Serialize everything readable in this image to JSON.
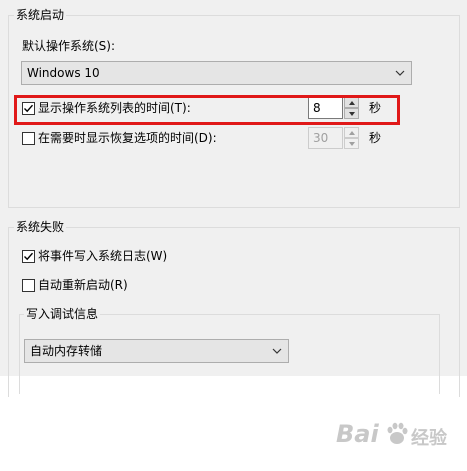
{
  "system_startup": {
    "group_title": "系统启动",
    "default_os_label": "默认操作系统(S):",
    "default_os_value": "Windows 10",
    "show_os_list": {
      "label": "显示操作系统列表的时间(T):",
      "checked": true,
      "value": "8",
      "unit": "秒"
    },
    "show_recovery": {
      "label": "在需要时显示恢复选项的时间(D):",
      "checked": false,
      "value": "30",
      "unit": "秒"
    }
  },
  "system_failure": {
    "group_title": "系统失败",
    "write_event_log": {
      "label": "将事件写入系统日志(W)",
      "checked": true
    },
    "auto_restart": {
      "label": "自动重新启动(R)",
      "checked": false
    },
    "debug_info": {
      "group_title": "写入调试信息",
      "dump_type": "自动内存转储"
    }
  },
  "watermark": {
    "brand": "Bai",
    "brand_suffix": "经验"
  },
  "colors": {
    "highlight": "#e01818",
    "dialog_bg": "#f0f0f0"
  }
}
